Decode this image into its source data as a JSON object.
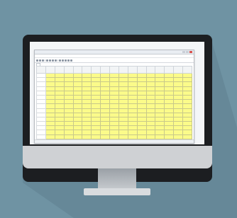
{
  "app": {
    "window_title": "",
    "menu": [
      "",
      "",
      "",
      "",
      "",
      "",
      ""
    ],
    "sheet_tabs": [
      ""
    ],
    "columns": [
      "",
      "",
      "",
      "",
      "",
      "",
      "",
      "",
      "",
      "",
      "",
      "",
      "",
      "",
      "",
      "",
      ""
    ],
    "rows": [
      {
        "idx": ""
      },
      {
        "idx": ""
      },
      {
        "idx": ""
      },
      {
        "idx": ""
      },
      {
        "idx": ""
      },
      {
        "idx": ""
      },
      {
        "idx": ""
      },
      {
        "idx": ""
      },
      {
        "idx": ""
      },
      {
        "idx": ""
      },
      {
        "idx": ""
      },
      {
        "idx": ""
      },
      {
        "idx": ""
      },
      {
        "idx": ""
      },
      {
        "idx": ""
      }
    ]
  },
  "colors": {
    "background": "#6f93a3",
    "cell_highlight": "#fbfb8a",
    "monitor_bezel": "#1c1e21",
    "monitor_chin": "#cfd1d4"
  }
}
